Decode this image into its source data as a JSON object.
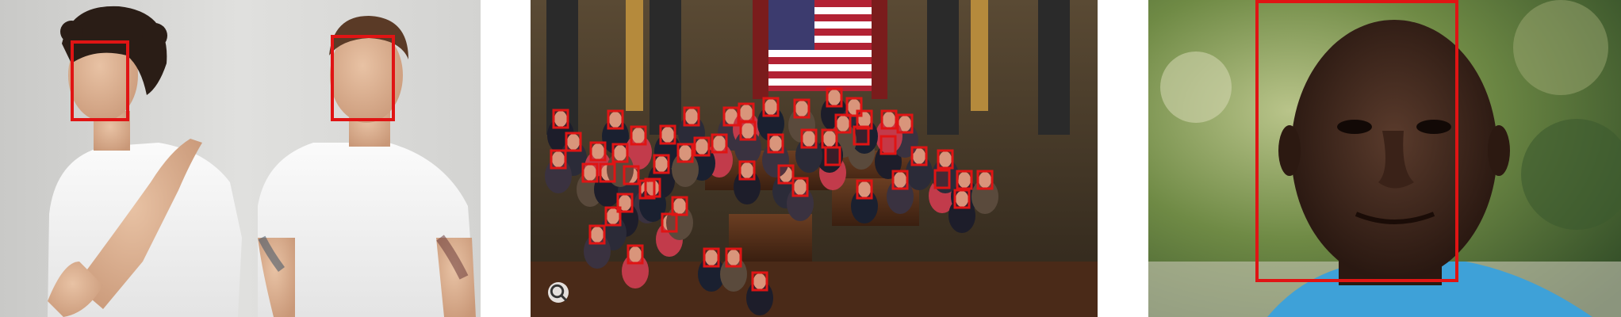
{
  "images": [
    {
      "scene": "two-young-men-white-tshirts",
      "face_count": 2,
      "box_color": "#e01414"
    },
    {
      "scene": "legislative-chamber-crowd",
      "face_count": 55,
      "box_color": "#e01414",
      "icon": "lens-search-icon"
    },
    {
      "scene": "close-up-portrait-man",
      "face_count": 1,
      "box_color": "#e01414"
    }
  ]
}
